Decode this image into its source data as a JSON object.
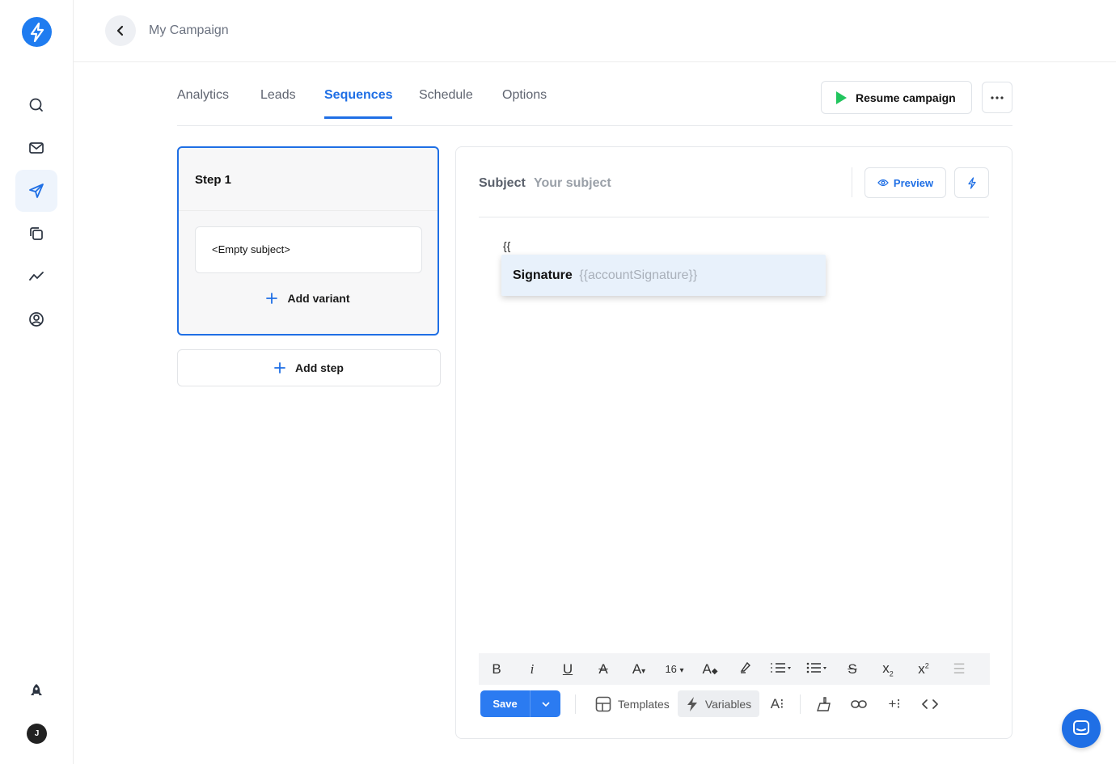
{
  "header": {
    "title": "My Campaign"
  },
  "tabs": [
    {
      "label": "Analytics"
    },
    {
      "label": "Leads"
    },
    {
      "label": "Sequences",
      "active": true
    },
    {
      "label": "Schedule"
    },
    {
      "label": "Options"
    }
  ],
  "actions": {
    "resume_label": "Resume campaign"
  },
  "sequence": {
    "step_title": "Step 1",
    "variant_subject": "<Empty subject>",
    "add_variant_label": "Add variant",
    "add_step_label": "Add step"
  },
  "editor": {
    "subject_label": "Subject",
    "subject_placeholder": "Your subject",
    "preview_label": "Preview",
    "body_text": "{{",
    "suggestion": {
      "name": "Signature",
      "variable": "{{accountSignature}}"
    },
    "font_size": "16",
    "save_label": "Save",
    "templates_label": "Templates",
    "variables_label": "Variables"
  },
  "sidebar": {
    "avatar_initial": "J"
  },
  "colors": {
    "accent": "#1f6fe5",
    "brand": "#1f7cf0",
    "play": "#22c55e"
  }
}
